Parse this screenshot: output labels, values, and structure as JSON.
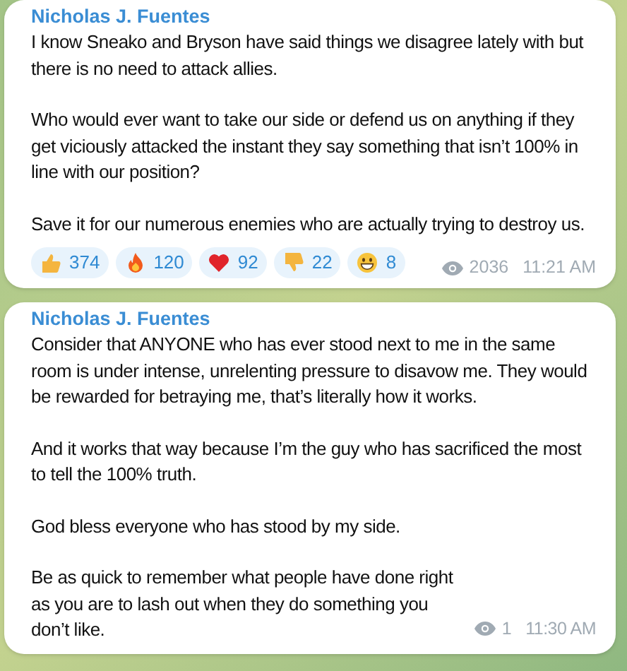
{
  "messages": [
    {
      "author": "Nicholas J. Fuentes",
      "paragraphs": [
        "I know Sneako and Bryson have said things we disagree lately with but there is no need to attack allies.",
        "Who would ever want to take our side or defend us on anything if they get viciously attacked the instant they say something that isn’t 100% in line with our position?",
        "Save it for our numerous enemies who are actually trying to destroy us."
      ],
      "reactions": [
        {
          "kind": "thumbs_up",
          "count": "374"
        },
        {
          "kind": "fire",
          "count": "120"
        },
        {
          "kind": "heart",
          "count": "92"
        },
        {
          "kind": "thumbs_down",
          "count": "22"
        },
        {
          "kind": "grin",
          "count": "8"
        }
      ],
      "views": "2036",
      "time": "11:21 AM"
    },
    {
      "author": "Nicholas J. Fuentes",
      "paragraphs": [
        "Consider that ANYONE who has ever stood next to me in the same room is under intense, unrelenting pressure to disavow me. They would be rewarded for betraying me, that’s literally how it works.",
        "And it works that way because I’m the guy who has sacrificed the most to tell the 100% truth.",
        "God bless everyone who has stood by my side.",
        "Be as quick to remember what people have done right as you are to lash out when they do something you don’t like."
      ],
      "views": "1",
      "time": "11:30 AM"
    }
  ]
}
